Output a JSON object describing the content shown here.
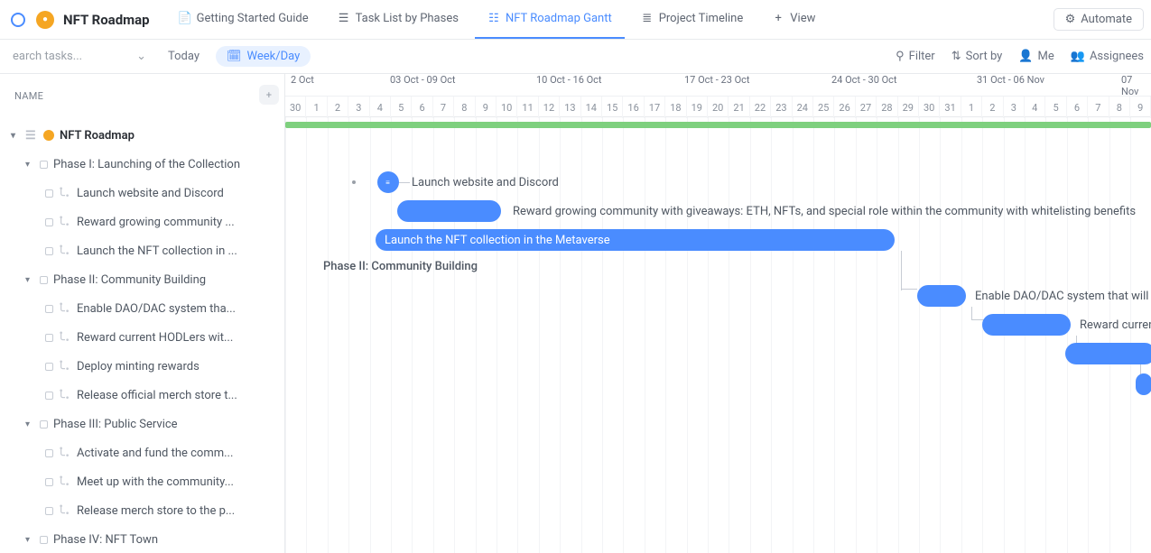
{
  "header": {
    "project_title": "NFT Roadmap",
    "tabs": [
      {
        "label": "Getting Started Guide",
        "icon": "doc-icon"
      },
      {
        "label": "Task List by Phases",
        "icon": "list-icon"
      },
      {
        "label": "NFT Roadmap Gantt",
        "icon": "gantt-icon",
        "active": true
      },
      {
        "label": "Project Timeline",
        "icon": "timeline-icon"
      },
      {
        "label": "View",
        "icon": "plus-icon"
      }
    ],
    "automate_label": "Automate"
  },
  "toolbar": {
    "search_placeholder": "earch tasks...",
    "today_label": "Today",
    "zoom_label": "Week/Day",
    "filter_label": "Filter",
    "sort_label": "Sort by",
    "me_label": "Me",
    "assignees_label": "Assignees"
  },
  "sidebar": {
    "name_header": "NAME",
    "root_label": "NFT Roadmap",
    "phases": [
      {
        "label": "Phase I: Launching of the Collection",
        "tasks": [
          "Launch website and Discord",
          "Reward growing community ...",
          "Launch the NFT collection in ..."
        ]
      },
      {
        "label": "Phase II: Community Building",
        "tasks": [
          "Enable DAO/DAC system tha...",
          "Reward current HODLers wit...",
          "Deploy minting rewards",
          "Release official merch store t..."
        ]
      },
      {
        "label": "Phase III: Public Service",
        "tasks": [
          "Activate and fund the comm...",
          "Meet up with the community...",
          "Release merch store to the p..."
        ]
      },
      {
        "label": "Phase IV: NFT Town",
        "tasks": []
      }
    ]
  },
  "timeline": {
    "week_ranges": [
      "2 Oct",
      "03 Oct - 09 Oct",
      "10 Oct - 16 Oct",
      "17 Oct - 23 Oct",
      "24 Oct - 30 Oct",
      "31 Oct - 06 Nov",
      "07 Nov"
    ],
    "days": [
      "30",
      "1",
      "2",
      "3",
      "4",
      "5",
      "6",
      "7",
      "8",
      "9",
      "10",
      "11",
      "12",
      "13",
      "14",
      "15",
      "16",
      "17",
      "18",
      "19",
      "20",
      "21",
      "22",
      "23",
      "24",
      "25",
      "26",
      "27",
      "28",
      "29",
      "30",
      "31",
      "1",
      "2",
      "3",
      "4",
      "5",
      "6",
      "7",
      "8",
      "9"
    ],
    "items": {
      "milestone_label": "Launch website and Discord",
      "bar1_label": "Reward growing community with giveaways: ETH, NFTs, and special role within the community with whitelisting benefits",
      "bar2_inner": "Launch the NFT collection in the Metaverse",
      "phase2_label": "Phase II: Community Building",
      "bar3_label": "Enable DAO/DAC system that will allow",
      "bar4_label": "Reward current"
    }
  },
  "chart_data": {
    "type": "gantt",
    "x_unit": "day",
    "x_start": "2022-09-30",
    "x_end": "2022-11-09",
    "groups": [
      {
        "name": "NFT Roadmap",
        "type": "summary",
        "start": "2022-09-30",
        "end": "2022-11-09"
      },
      {
        "name": "Phase I: Launching of the Collection",
        "type": "group",
        "tasks": [
          {
            "name": "Launch website and Discord",
            "type": "milestone",
            "date": "2022-10-04"
          },
          {
            "name": "Reward growing community with giveaways: ETH, NFTs, and special role within the community with whitelisting benefits",
            "start": "2022-10-05",
            "end": "2022-10-09"
          },
          {
            "name": "Launch the NFT collection in the Metaverse",
            "start": "2022-10-04",
            "end": "2022-10-28"
          }
        ]
      },
      {
        "name": "Phase II: Community Building",
        "type": "group",
        "tasks": [
          {
            "name": "Enable DAO/DAC system that will allow",
            "start": "2022-10-29",
            "end": "2022-11-01"
          },
          {
            "name": "Reward current HODLers",
            "start": "2022-11-02",
            "end": "2022-11-06"
          },
          {
            "name": "Deploy minting rewards",
            "start": "2022-11-06",
            "end": "2022-11-09"
          },
          {
            "name": "Release official merch store",
            "start": "2022-11-09",
            "end": "2022-11-09"
          }
        ]
      }
    ]
  }
}
